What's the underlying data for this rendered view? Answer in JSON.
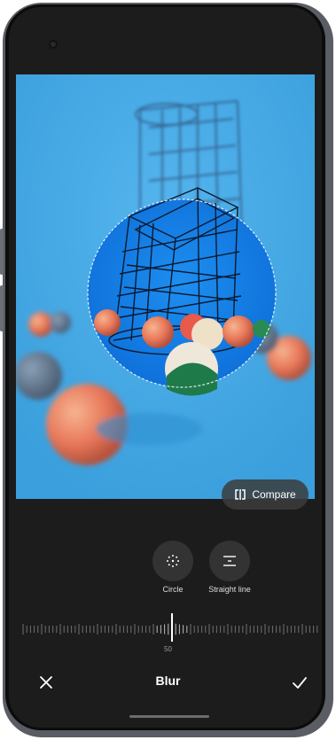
{
  "app": {
    "title": "Blur"
  },
  "photo": {
    "description_icon": "photo-preview"
  },
  "compare_button": {
    "label": "Compare",
    "icon": "compare-icon"
  },
  "tools": [
    {
      "id": "circle",
      "label": "Circle",
      "icon": "circle-blur-icon",
      "selected": true
    },
    {
      "id": "straight-line",
      "label": "Straight line",
      "icon": "straight-line-blur-icon",
      "selected": false
    }
  ],
  "slider": {
    "value_label": "50",
    "value": 50
  },
  "bottom_bar": {
    "title": "Blur",
    "cancel_icon": "close-icon",
    "confirm_icon": "checkmark-icon"
  },
  "colors": {
    "background": "#1c1c1c",
    "photo_blue": "#2f9fe0",
    "text": "#ffffff"
  }
}
